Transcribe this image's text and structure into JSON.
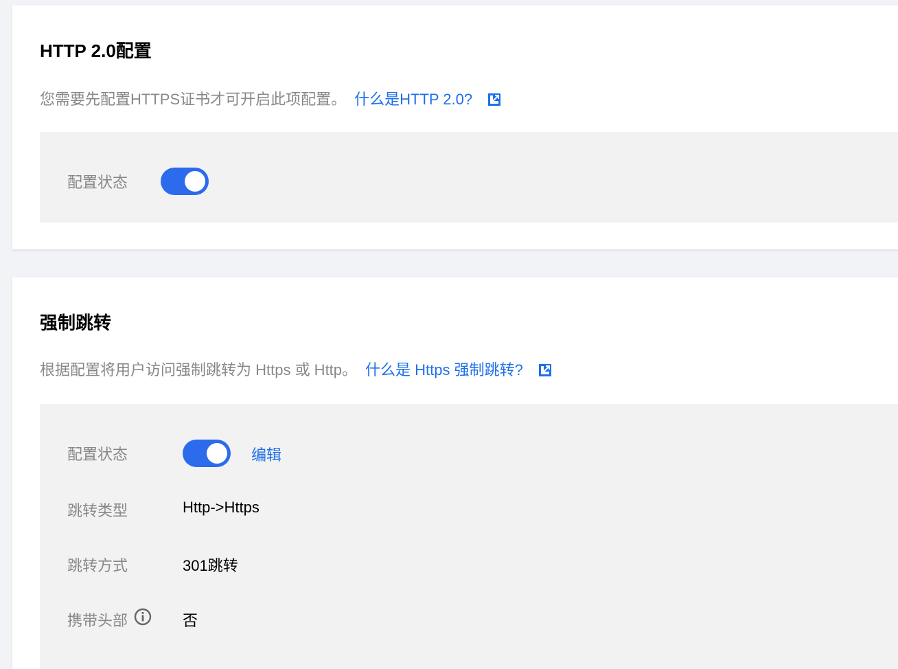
{
  "http2": {
    "title": "HTTP 2.0配置",
    "description": "您需要先配置HTTPS证书才可开启此项配置。",
    "doc_link": "什么是HTTP 2.0?",
    "status_label": "配置状态",
    "status_enabled": true
  },
  "redirect": {
    "title": "强制跳转",
    "description": "根据配置将用户访问强制跳转为 Https 或 Http。",
    "doc_link": "什么是 Https 强制跳转?",
    "status_label": "配置状态",
    "status_enabled": true,
    "edit_label": "编辑",
    "fields": [
      {
        "label": "跳转类型",
        "value": "Http->Https"
      },
      {
        "label": "跳转方式",
        "value": "301跳转"
      },
      {
        "label": "携带头部",
        "value": "否"
      }
    ]
  },
  "icons": {
    "external_link": "external-link-icon",
    "info": "info-icon"
  },
  "colors": {
    "accent": "#1e6fe8",
    "toggle_on": "#2b6bec",
    "panel_bg": "#f2f2f2",
    "page_bg": "#f2f3f6",
    "muted_text": "#888888"
  }
}
